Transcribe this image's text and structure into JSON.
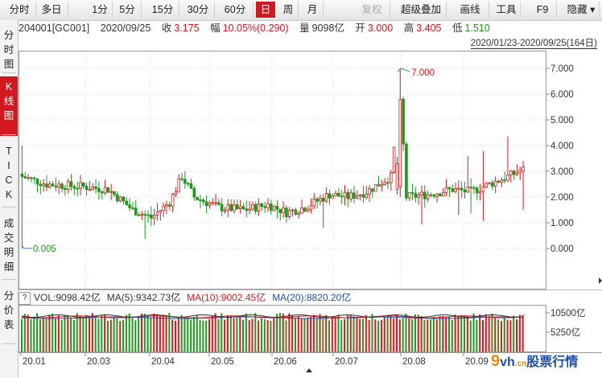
{
  "toolbar": {
    "items": [
      {
        "label": "分时",
        "x": 4,
        "w": 40
      },
      {
        "label": "多日",
        "x": 44,
        "w": 40
      },
      {
        "label": "1分",
        "x": 109,
        "w": 30
      },
      {
        "label": "5分",
        "x": 141,
        "w": 34
      },
      {
        "label": "15分",
        "x": 182,
        "w": 40
      },
      {
        "label": "30分",
        "x": 226,
        "w": 40
      },
      {
        "label": "60分",
        "x": 270,
        "w": 44
      },
      {
        "label": "日",
        "x": 318,
        "w": 24,
        "active": true
      },
      {
        "label": "周",
        "x": 346,
        "w": 24
      },
      {
        "label": "月",
        "x": 375,
        "w": 26
      },
      {
        "label": "复权",
        "x": 440,
        "w": 44,
        "disabled": true
      },
      {
        "label": "超级叠加",
        "x": 492,
        "w": 62
      },
      {
        "label": "画线",
        "x": 561,
        "w": 46
      },
      {
        "label": "工具",
        "x": 612,
        "w": 34
      },
      {
        "label": "F9",
        "x": 657,
        "w": 34
      },
      {
        "label": "隐藏",
        "x": 700,
        "w": 44,
        "caret": true
      }
    ]
  },
  "sidebar": {
    "tabs": [
      {
        "label": "分时图",
        "top": 6,
        "h": 57
      },
      {
        "label": "K线图",
        "top": 70,
        "h": 70,
        "active": true
      },
      {
        "label": "TICK",
        "top": 150,
        "h": 80
      },
      {
        "label": "成交明细",
        "top": 240,
        "h": 80
      },
      {
        "label": "分价表",
        "top": 330,
        "h": 70
      }
    ]
  },
  "info": {
    "code": "204001[GC001]",
    "date": "2020/09/25",
    "close_label": "收",
    "close": "3.175",
    "change_label": "幅",
    "change": "10.05%(0.290)",
    "volume_label": "量",
    "volume": "9098亿",
    "open_label": "开",
    "open": "3.000",
    "high_label": "高",
    "high": "3.405",
    "low_label": "低",
    "low": "1.510"
  },
  "range": "2020/01/23-2020/09/25(164日)",
  "annotations": {
    "high": "7.000",
    "low": "0.005"
  },
  "price_axis": [
    "7.000",
    "6.000",
    "5.000",
    "4.000",
    "3.000",
    "2.000",
    "1.000",
    "0.000"
  ],
  "volume_axis": [
    "10500亿",
    "5250亿"
  ],
  "date_axis": [
    "20.01",
    "20.03",
    "20.04",
    "20.05",
    "20.06",
    "20.07",
    "20.08",
    "20.09"
  ],
  "volume_legend": {
    "vol": "VOL:9098.42亿",
    "ma5": "MA(5):9342.73亿",
    "ma10": "MA(10):9002.45亿",
    "ma20": "MA(20):8820.20亿"
  },
  "colors": {
    "up": "#e0161b",
    "down": "#1b9a1b",
    "ma5": "#333333",
    "ma10": "#e0161b",
    "ma20": "#1a4fb3",
    "active": "#d4181f"
  },
  "logo": {
    "num": "9",
    "vh": "vh",
    "cn": ".cn",
    "text": "股票行情"
  },
  "chart_data": {
    "type": "candlestick",
    "title": "",
    "series_name": "204001[GC001]",
    "date_range": [
      "2020/01/23",
      "2020/09/25"
    ],
    "ylim": [
      0,
      7
    ],
    "y_ticks": [
      0,
      1,
      2,
      3,
      4,
      5,
      6,
      7
    ],
    "volume_ticks": [
      5250,
      10500
    ],
    "volume_unit": "亿",
    "x_ticks": [
      "20.01",
      "20.03",
      "20.04",
      "20.05",
      "20.06",
      "20.07",
      "20.08",
      "20.09"
    ],
    "annotated_high": 7.0,
    "annotated_low": 0.005,
    "last": {
      "date": "2020/09/25",
      "open": 3.0,
      "high": 3.405,
      "low": 1.51,
      "close": 3.175,
      "volume": 9098.42,
      "ma5": 9342.73,
      "ma10": 9002.45,
      "ma20": 8820.2
    }
  }
}
